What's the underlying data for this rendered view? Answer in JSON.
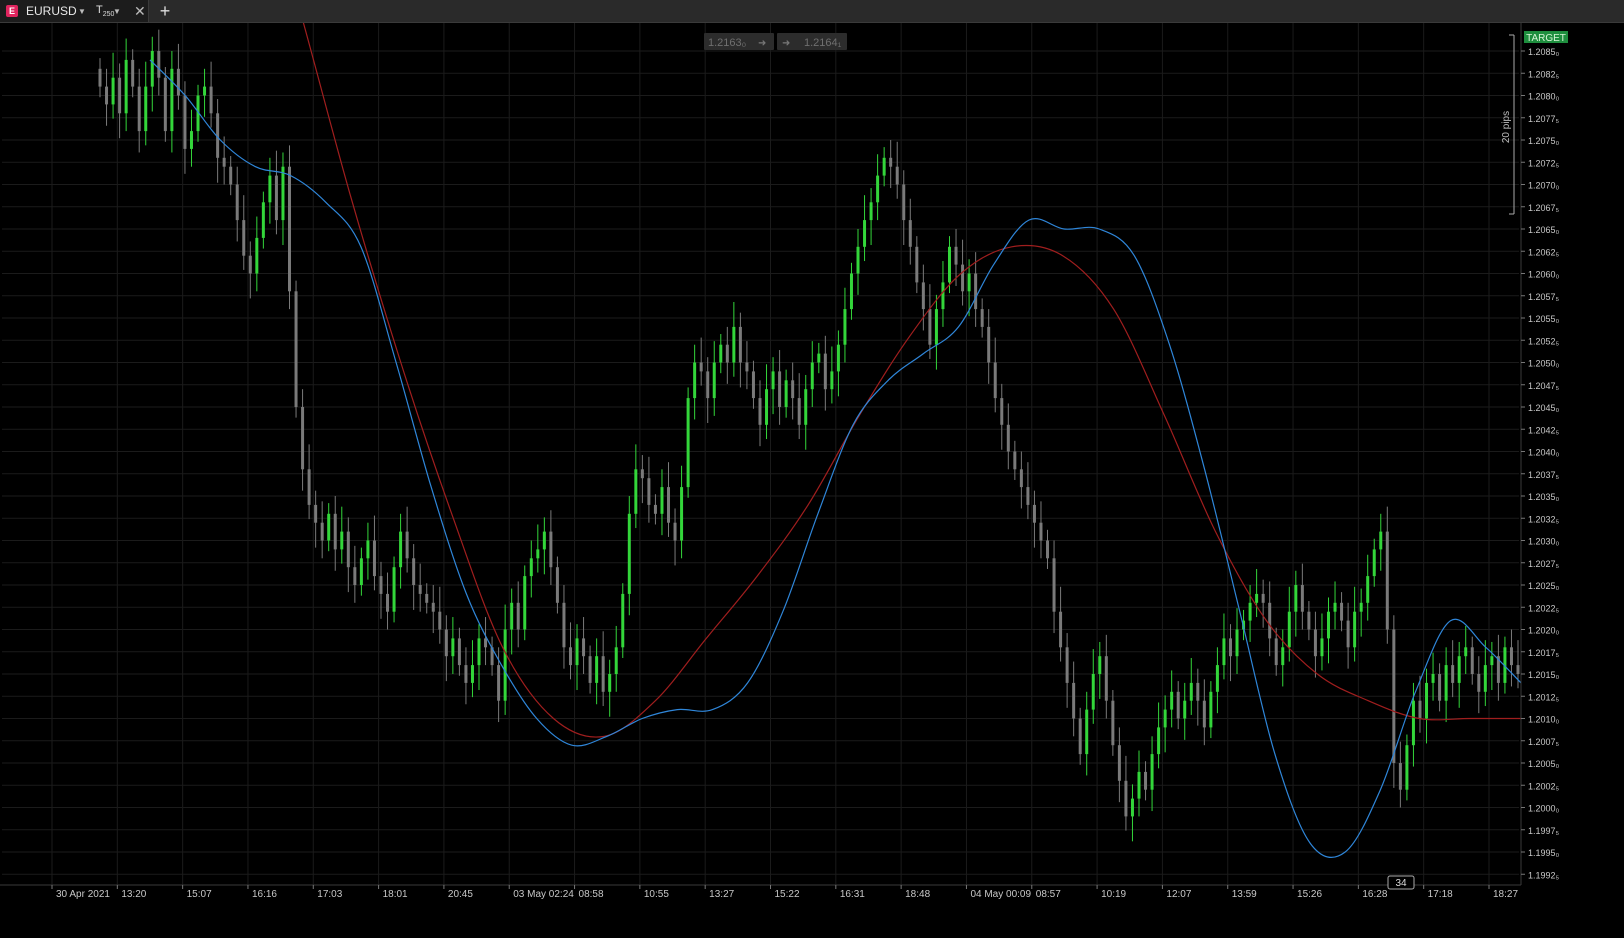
{
  "tab": {
    "symbol_badge": "E",
    "symbol": "EURUSD",
    "timeframe_letter": "T",
    "timeframe_count": "250"
  },
  "quote_buttons": {
    "sell": "1.2163₀",
    "buy": "1.2164₁"
  },
  "target_label": "TARGET",
  "pips_label": "20 pips",
  "countdown": "34",
  "price_axis": [
    "1.2085₀",
    "1.2082₅",
    "1.2080₀",
    "1.2077₅",
    "1.2075₀",
    "1.2072₅",
    "1.2070₀",
    "1.2067₅",
    "1.2065₀",
    "1.2062₅",
    "1.2060₀",
    "1.2057₅",
    "1.2055₀",
    "1.2052₅",
    "1.2050₀",
    "1.2047₅",
    "1.2045₀",
    "1.2042₅",
    "1.2040₀",
    "1.2037₅",
    "1.2035₀",
    "1.2032₅",
    "1.2030₀",
    "1.2027₅",
    "1.2025₀",
    "1.2022₅",
    "1.2020₀",
    "1.2017₅",
    "1.2015₀",
    "1.2012₅",
    "1.2010₀",
    "1.2007₅",
    "1.2005₀",
    "1.2002₅",
    "1.2000₀",
    "1.1997₅",
    "1.1995₀",
    "1.1992₅"
  ],
  "time_axis": [
    "30 Apr 2021",
    "13:20",
    "15:07",
    "16:16",
    "17:03",
    "18:01",
    "20:45",
    "03 May 02:24",
    "08:58",
    "10:55",
    "13:27",
    "15:22",
    "16:31",
    "18:48",
    "04 May 00:09",
    "08:57",
    "10:19",
    "12:07",
    "13:59",
    "15:26",
    "16:28",
    "17:18",
    "18:27"
  ],
  "colors": {
    "bull": "#33d63a",
    "bear": "#7a7a7a",
    "ma_fast": "#2f86d9",
    "ma_slow": "#a01e1e",
    "grid": "#1b1b1b",
    "target_bg": "#1e8e3e"
  },
  "chart_data": {
    "type": "candlestick",
    "ylim": [
      1.19925,
      1.2087
    ],
    "closes": [
      1.2083,
      1.2081,
      1.2084,
      1.208,
      1.2086,
      1.2083,
      1.2078,
      1.2083,
      1.2087,
      1.2084,
      1.2078,
      1.2085,
      1.2082,
      1.2076,
      1.2078,
      1.2082,
      1.2083,
      1.208,
      1.2075,
      1.2074,
      1.2072,
      1.2068,
      1.2064,
      1.2062,
      1.2066,
      1.207,
      1.2073,
      1.2068,
      1.2074,
      1.206,
      1.2047,
      1.204,
      1.2036,
      1.2034,
      1.2032,
      1.2035,
      1.2031,
      1.2033,
      1.2029,
      1.2027,
      1.203,
      1.2032,
      1.2028,
      1.2026,
      1.2024,
      1.2029,
      1.2033,
      1.203,
      1.2027,
      1.2026,
      1.2025,
      1.2024,
      1.2022,
      1.2019,
      1.2021,
      1.2018,
      1.2016,
      1.2018,
      1.2021,
      1.202,
      1.2018,
      1.2014,
      1.2022,
      1.2025,
      1.2022,
      1.2028,
      1.203,
      1.2031,
      1.2033,
      1.2029,
      1.2025,
      1.202,
      1.2018,
      1.2021,
      1.2019,
      1.2016,
      1.2019,
      1.2015,
      1.2017,
      1.202,
      1.2026,
      1.2035,
      1.204,
      1.2039,
      1.2036,
      1.2035,
      1.2038,
      1.2034,
      1.2032,
      1.2038,
      1.2048,
      1.2052,
      1.2051,
      1.2048,
      1.2052,
      1.2054,
      1.2052,
      1.2056,
      1.2052,
      1.2051,
      1.2048,
      1.2045,
      1.2049,
      1.2051,
      1.2047,
      1.205,
      1.2048,
      1.2045,
      1.2049,
      1.2052,
      1.2053,
      1.2049,
      1.2051,
      1.2054,
      1.2058,
      1.2062,
      1.2065,
      1.2068,
      1.207,
      1.2073,
      1.2075,
      1.2074,
      1.2072,
      1.2068,
      1.2065,
      1.2061,
      1.2058,
      1.2054,
      1.2058,
      1.2061,
      1.2065,
      1.2063,
      1.206,
      1.2062,
      1.2058,
      1.2056,
      1.2052,
      1.2048,
      1.2045,
      1.2042,
      1.204,
      1.2038,
      1.2036,
      1.2034,
      1.2032,
      1.203,
      1.2024,
      1.202,
      1.2016,
      1.2012,
      1.2008,
      1.2013,
      1.2017,
      1.2019,
      1.2014,
      1.2009,
      1.2005,
      1.2001,
      1.2003,
      1.2006,
      1.2004,
      1.2008,
      1.2011,
      1.2013,
      1.2015,
      1.2012,
      1.2014,
      1.2016,
      1.2014,
      1.2011,
      1.2015,
      1.2018,
      1.2021,
      1.2019,
      1.2022,
      1.2023,
      1.2025,
      1.2026,
      1.2025,
      1.2021,
      1.2018,
      1.202,
      1.2024,
      1.2027,
      1.2024,
      1.2022,
      1.2019,
      1.2021,
      1.2024,
      1.2025,
      1.2023,
      1.202,
      1.2024,
      1.2025,
      1.2028,
      1.2031,
      1.2033,
      1.2022,
      1.2007,
      1.2004,
      1.2009,
      1.2014,
      1.2012,
      1.2016,
      1.2017,
      1.2014,
      1.2018,
      1.2016,
      1.2019,
      1.202,
      1.2017,
      1.2015,
      1.2018,
      1.2019,
      1.2016,
      1.202,
      1.2018,
      1.2017
    ],
    "ma_fast": [
      1.2086,
      1.2082,
      1.2077,
      1.2074,
      1.2073,
      1.207,
      1.2065,
      1.2052,
      1.2038,
      1.2026,
      1.2018,
      1.2012,
      1.2009,
      1.201,
      1.2012,
      1.2013,
      1.2013,
      1.2016,
      1.2024,
      1.2035,
      1.2045,
      1.205,
      1.2053,
      1.2056,
      1.2063,
      1.2068,
      1.2067,
      1.2067,
      1.2064,
      1.2054,
      1.204,
      1.2024,
      1.2008,
      1.1998,
      1.1997,
      1.2004,
      1.2015,
      1.2023,
      1.202,
      1.2016
    ],
    "ma_slow": [
      1.2112,
      1.2092,
      1.2071,
      1.2052,
      1.2035,
      1.202,
      1.2012,
      1.201,
      1.2014,
      1.2021,
      1.2028,
      1.2036,
      1.2046,
      1.2055,
      1.2062,
      1.2065,
      1.2064,
      1.2058,
      1.2046,
      1.2033,
      1.2023,
      1.2017,
      1.2014,
      1.2012,
      1.2012,
      1.2012
    ]
  }
}
